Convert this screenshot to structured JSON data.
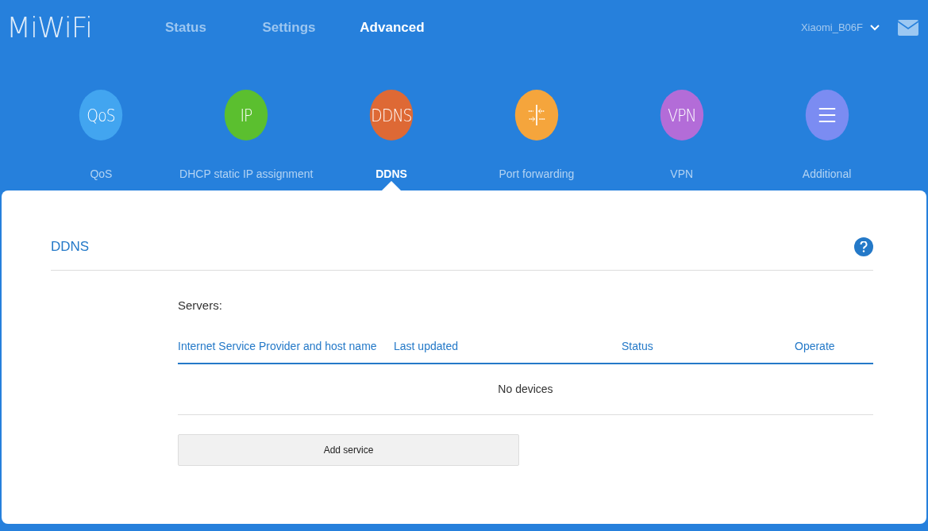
{
  "logo": "MiWiFi",
  "nav": [
    {
      "label": "Status",
      "selected": false
    },
    {
      "label": "Settings",
      "selected": false
    },
    {
      "label": "Advanced",
      "selected": true
    }
  ],
  "router_name": "Xiaomi_B06F",
  "features": [
    {
      "kind": "text",
      "icon_text": "QoS",
      "label": "QoS",
      "color": "#42a5f0",
      "selected": false
    },
    {
      "kind": "text",
      "icon_text": "IP",
      "label": "DHCP static IP assignment",
      "color": "#5bbf2f",
      "selected": false
    },
    {
      "kind": "text",
      "icon_text": "DDNS",
      "label": "DDNS",
      "color": "#de6935",
      "selected": true
    },
    {
      "kind": "ports",
      "label": "Port forwarding",
      "color": "#f5a53c",
      "selected": false
    },
    {
      "kind": "text",
      "icon_text": "VPN",
      "label": "VPN",
      "color": "#b36cd8",
      "selected": false
    },
    {
      "kind": "menu",
      "label": "Additional",
      "color": "#7b8cf2",
      "selected": false
    }
  ],
  "section_title": "DDNS",
  "servers_label": "Servers:",
  "table": {
    "columns": [
      "Internet Service Provider and host name",
      "Last updated",
      "Status",
      "Operate"
    ],
    "empty_text": "No devices"
  },
  "add_button": "Add service"
}
